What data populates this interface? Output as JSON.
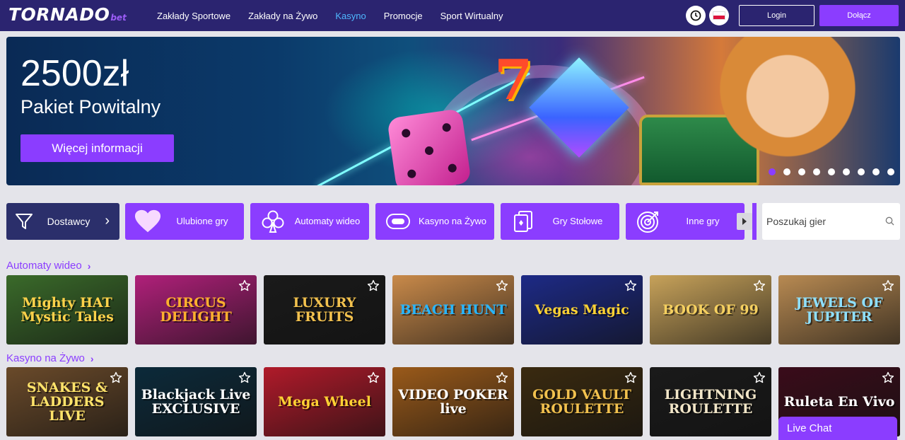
{
  "brand": {
    "name_main": "TORNADO",
    "name_suffix": "bet"
  },
  "nav": {
    "items": [
      {
        "label": "Zakłady Sportowe",
        "active": false
      },
      {
        "label": "Zakłady na Żywo",
        "active": false
      },
      {
        "label": "Kasyno",
        "active": true
      },
      {
        "label": "Promocje",
        "active": false
      },
      {
        "label": "Sport Wirtualny",
        "active": false
      }
    ],
    "active_color": "#4fb8ff"
  },
  "header_icons": {
    "clock": "clock-icon",
    "language": "poland-flag-icon"
  },
  "auth": {
    "login_label": "Login",
    "join_label": "Dołącz"
  },
  "hero": {
    "title": "2500zł",
    "subtitle": "Pakiet Powitalny",
    "cta_label": "Więcej informacji",
    "slide_count": 9,
    "active_slide": 1
  },
  "categories": {
    "providers_label": "Dostawcy",
    "items": [
      {
        "label": "Ulubione gry",
        "icon": "heart-icon"
      },
      {
        "label": "Automaty wideo",
        "icon": "club-icon"
      },
      {
        "label": "Kasyno na Żywo",
        "icon": "casino-chip-icon"
      },
      {
        "label": "Gry Stołowe",
        "icon": "playing-cards-icon"
      },
      {
        "label": "Inne gry",
        "icon": "target-icon"
      }
    ]
  },
  "search": {
    "placeholder": "Poszukaj gier"
  },
  "sections": [
    {
      "title": "Automaty wideo",
      "games": [
        {
          "name": "Mighty HAT Mystic Tales",
          "bg": "#3a6a2a",
          "fg": "#ffd24a",
          "favoritable": false
        },
        {
          "name": "CIRCUS DELIGHT",
          "bg": "#b0207a",
          "fg": "#ffb02e",
          "favoritable": true
        },
        {
          "name": "LUXURY FRUITS",
          "bg": "#1a1a1a",
          "fg": "#f2c14e",
          "favoritable": true
        },
        {
          "name": "BEACH HUNT",
          "bg": "#c98a4a",
          "fg": "#28b6ff",
          "favoritable": true
        },
        {
          "name": "Vegas Magic",
          "bg": "#1d2a86",
          "fg": "#ffd233",
          "favoritable": true
        },
        {
          "name": "BOOK OF 99",
          "bg": "#c7a25a",
          "fg": "#f5d060",
          "favoritable": true
        },
        {
          "name": "JEWELS OF JUPITER",
          "bg": "#b88a52",
          "fg": "#8ee0ff",
          "favoritable": true
        }
      ]
    },
    {
      "title": "Kasyno na Żywo",
      "games": [
        {
          "name": "SNAKES & LADDERS LIVE",
          "bg": "#6a4a2a",
          "fg": "#ffe36a",
          "favoritable": true
        },
        {
          "name": "Blackjack Live EXCLUSIVE",
          "bg": "#0c2a3a",
          "fg": "#ffffff",
          "favoritable": true
        },
        {
          "name": "Mega Wheel",
          "bg": "#b01a2a",
          "fg": "#ffd233",
          "favoritable": true
        },
        {
          "name": "VIDEO POKER live",
          "bg": "#9a5a1a",
          "fg": "#ffffff",
          "favoritable": true
        },
        {
          "name": "GOLD VAULT ROULETTE",
          "bg": "#3a2a10",
          "fg": "#f2c14e",
          "favoritable": true
        },
        {
          "name": "LIGHTNING ROULETTE",
          "bg": "#1a1a1a",
          "fg": "#f2e6c8",
          "favoritable": true
        },
        {
          "name": "Ruleta En Vivo",
          "bg": "#3a0c1a",
          "fg": "#ffffff",
          "favoritable": true
        }
      ]
    }
  ],
  "live_chat": {
    "label": "Live Chat"
  },
  "colors": {
    "topbar": "#2b2470",
    "accent": "#8b3dff",
    "providers": "#2b2f6b",
    "page_bg": "#e4e4ea"
  }
}
